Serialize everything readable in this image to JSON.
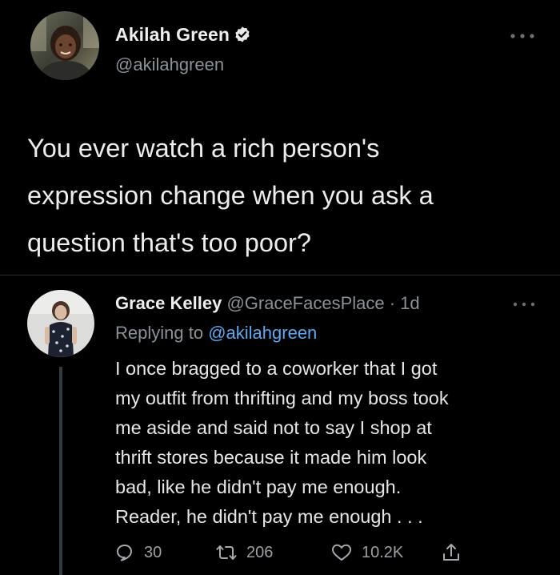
{
  "main_tweet": {
    "author_name": "Akilah Green",
    "author_handle": "@akilahgreen",
    "text": "You ever watch a rich person's\nexpression change when you ask a\nquestion that's too poor?",
    "icons": {
      "avatar": "avatar-photo",
      "verified": "verified-badge-icon",
      "more": "more-dots-icon"
    }
  },
  "reply": {
    "author_name": "Grace Kelley",
    "author_handle_and_time": "@GraceFacesPlace · 1d",
    "replying_to_label": "Replying to",
    "replying_to_handle": "@akilahgreen",
    "text": "I once bragged to a coworker that I got\nmy outfit from thrifting and my boss took\nme aside and said not to say I shop at\nthrift stores because it made him look\nbad, like he didn't pay me enough.\nReader, he didn't pay me enough . . .",
    "actions": {
      "reply_count": "30",
      "retweet_count": "206",
      "like_count": "10.2K"
    }
  },
  "colors": {
    "background": "#000000",
    "primary_text": "#e7e9ea",
    "secondary_text": "#8b9199",
    "link": "#5aa9f2",
    "divider": "#2a2d31"
  }
}
